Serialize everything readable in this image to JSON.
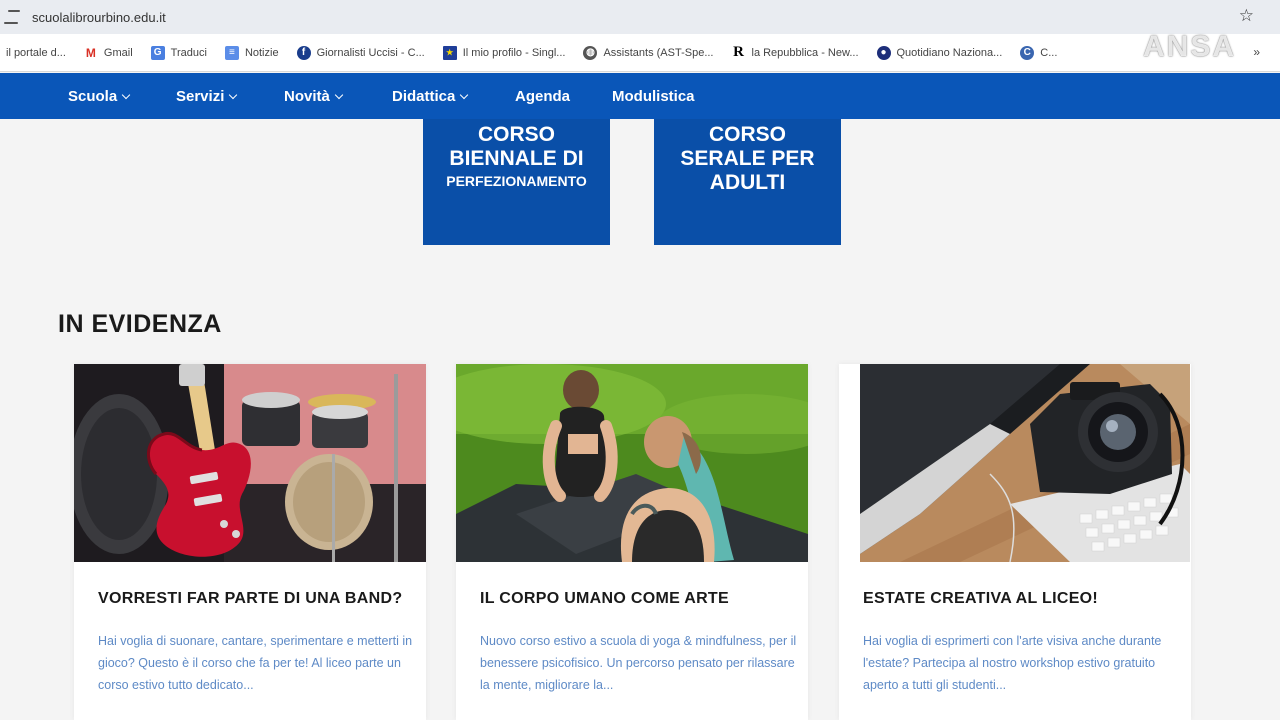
{
  "browser": {
    "url": "scuolalibrourbino.edu.it",
    "bookmarks": [
      {
        "label": "il portale d...",
        "icon": "globe-icon"
      },
      {
        "label": "Gmail",
        "icon": "gmail-icon"
      },
      {
        "label": "Traduci",
        "icon": "translate-icon"
      },
      {
        "label": "Notizie",
        "icon": "news-icon"
      },
      {
        "label": "Giornalisti Uccisi - C...",
        "icon": "site-icon"
      },
      {
        "label": "Il mio profilo - Singl...",
        "icon": "eu-flag-icon"
      },
      {
        "label": "Assistants (AST-Spe...",
        "icon": "globe-icon"
      },
      {
        "label": "la Repubblica - New...",
        "icon": "repubblica-icon"
      },
      {
        "label": "Quotidiano Naziona...",
        "icon": "site-icon"
      },
      {
        "label": "C...",
        "icon": "site-icon"
      }
    ],
    "more_label": "»"
  },
  "watermark": "ANSA",
  "nav": {
    "items": [
      {
        "label": "Scuola",
        "dropdown": true
      },
      {
        "label": "Servizi",
        "dropdown": true
      },
      {
        "label": "Novità",
        "dropdown": true
      },
      {
        "label": "Didattica",
        "dropdown": true
      },
      {
        "label": "Agenda",
        "dropdown": false
      },
      {
        "label": "Modulistica",
        "dropdown": false
      }
    ]
  },
  "tiles": [
    {
      "line1": "CORSO",
      "line2": "BIENNALE DI",
      "line3": "PERFEZIONAMENTO"
    },
    {
      "line1": "CORSO",
      "line2": "SERALE PER",
      "line3": "ADULTI"
    }
  ],
  "section": {
    "title": "IN EVIDENZA"
  },
  "cards": [
    {
      "title": "VORRESTI FAR PARTE DI UNA BAND?",
      "desc": "Hai voglia di suonare, cantare, sperimentare e metterti in gioco? Questo è il corso che fa per te! Al liceo parte un corso estivo tutto dedicato..."
    },
    {
      "title": "IL CORPO UMANO COME ARTE",
      "desc": "Nuovo corso estivo a scuola di yoga & mindfulness, per il benessere psicofisico. Un percorso pensato per rilassare la mente, migliorare la..."
    },
    {
      "title": "ESTATE CREATIVA AL LICEO!",
      "desc": "Hai voglia di esprimerti con l'arte visiva anche durante l'estate? Partecipa al nostro workshop estivo gratuito aperto a tutti gli studenti..."
    }
  ],
  "colors": {
    "nav_blue": "#0a56b8",
    "tile_blue": "#0a4fa8",
    "desc_blue": "#5e8ac6"
  }
}
